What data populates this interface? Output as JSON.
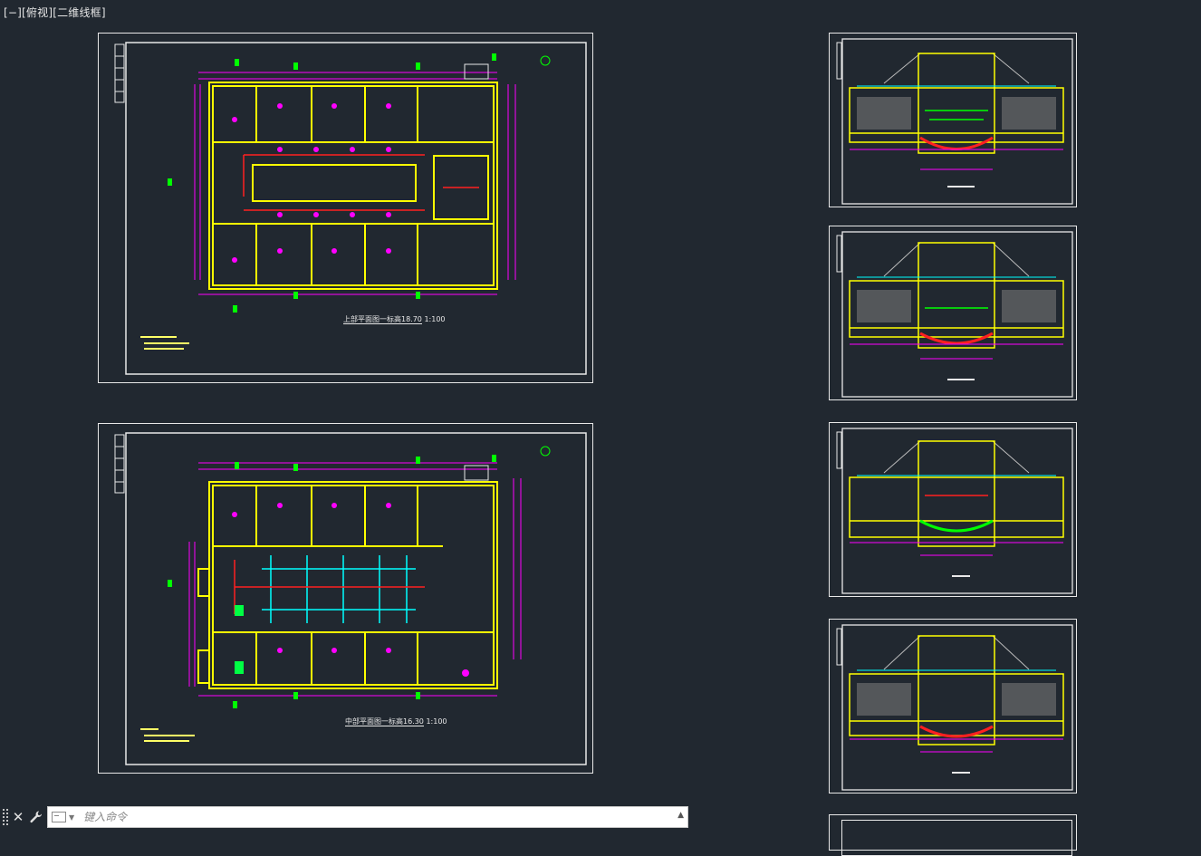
{
  "viewport": {
    "minus": "[−]",
    "view": "[俯视]",
    "style": "[二维线框]"
  },
  "sheets": [
    {
      "title": "上部平面图一标高18.70",
      "scale": "1:100"
    },
    {
      "title": "中部平面图一标高16.30",
      "scale": "1:100"
    }
  ],
  "command_line": {
    "placeholder": "键入命令"
  },
  "colors": {
    "background": "#212830",
    "wall": "#ffff00",
    "dimension": "#ff00ff",
    "axis": "#00ff00",
    "pipe_red": "#ff2020",
    "pipe_cyan": "#00ffff",
    "frame": "#e8e8e8"
  },
  "icons": {
    "close": "close-icon",
    "settings": "wrench-icon",
    "prompt": "command-prompt-icon"
  }
}
